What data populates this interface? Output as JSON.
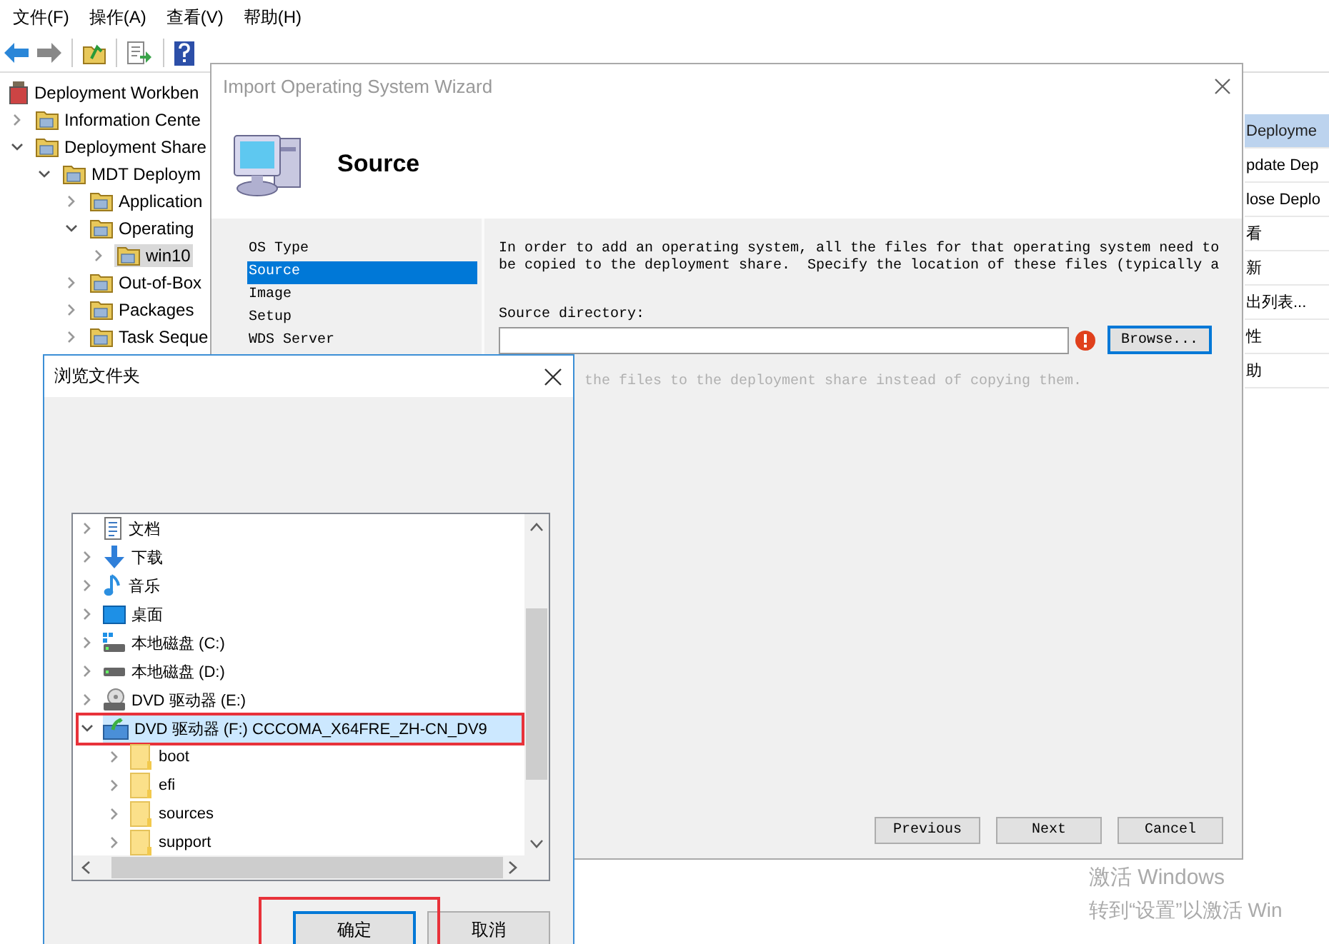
{
  "menu_bar": [
    "文件(F)",
    "操作(A)",
    "查看(V)",
    "帮助(H)"
  ],
  "tree": [
    {
      "label": "Deployment Workben",
      "selected": false,
      "children": [
        {
          "label": "Information Cente",
          "expanded": false,
          "selected": false
        },
        {
          "label": "Deployment Share",
          "expanded": true,
          "selected": false,
          "children": [
            {
              "label": "MDT Deploym",
              "expanded": true,
              "selected": false,
              "children": [
                {
                  "label": "Application",
                  "expanded": false,
                  "selected": false
                },
                {
                  "label": "Operating",
                  "expanded": true,
                  "selected": false,
                  "children": [
                    {
                      "label": "win10",
                      "expanded": false,
                      "selected": true
                    }
                  ]
                },
                {
                  "label": "Out-of-Box",
                  "expanded": false,
                  "selected": false
                },
                {
                  "label": "Packages",
                  "expanded": false,
                  "selected": false
                },
                {
                  "label": "Task Seque",
                  "expanded": false,
                  "selected": false
                }
              ]
            }
          ]
        }
      ]
    }
  ],
  "actions_pane": [
    {
      "label": "Deployme",
      "selected": true
    },
    {
      "label": "pdate Dep",
      "selected": false
    },
    {
      "label": "lose Deplo",
      "selected": false
    },
    {
      "label": "看",
      "selected": false
    },
    {
      "label": "新",
      "selected": false
    },
    {
      "label": "出列表...",
      "selected": false
    },
    {
      "label": "性",
      "selected": false
    },
    {
      "label": "助",
      "selected": false
    }
  ],
  "wizard": {
    "title": "Import Operating System Wizard",
    "heading": "Source",
    "steps": [
      {
        "label": "OS Type",
        "selected": false
      },
      {
        "label": "Source",
        "selected": true
      },
      {
        "label": "Image",
        "selected": false
      },
      {
        "label": "Setup",
        "selected": false
      },
      {
        "label": "WDS Server",
        "selected": false
      }
    ],
    "intro": [
      "In order to add an operating system, all the files for that operating system need to",
      "be copied to the deployment share.  Specify the location of these files (typically a"
    ],
    "source_label": "Source directory:",
    "source_error": true,
    "browse_button": "Browse...",
    "copy_option": {
      "label": "the files to the deployment share instead of copying them.",
      "disabled": true
    },
    "buttons": [
      "Previous",
      "Next",
      "Cancel"
    ]
  },
  "browse_dialog": {
    "title": "浏览文件夹",
    "items": [
      {
        "kind": "documents",
        "label": "文档",
        "expanded": false,
        "selected": false,
        "highlighted": false
      },
      {
        "kind": "downloads",
        "label": "下载",
        "expanded": false,
        "selected": false,
        "highlighted": false
      },
      {
        "kind": "music",
        "label": "音乐",
        "expanded": false,
        "selected": false,
        "highlighted": false
      },
      {
        "kind": "desktop",
        "label": "桌面",
        "expanded": false,
        "selected": false,
        "highlighted": false
      },
      {
        "kind": "system_disk",
        "label": "本地磁盘 (C:)",
        "expanded": false,
        "selected": false,
        "highlighted": false
      },
      {
        "kind": "disk",
        "label": "本地磁盘 (D:)",
        "expanded": false,
        "selected": false,
        "highlighted": false
      },
      {
        "kind": "dvd",
        "label": "DVD 驱动器 (E:)",
        "expanded": false,
        "selected": false,
        "highlighted": false
      },
      {
        "kind": "dvd_media",
        "label": "DVD 驱动器 (F:) CCCOMA_X64FRE_ZH-CN_DV9",
        "expanded": true,
        "selected": true,
        "highlighted": true,
        "children": [
          {
            "kind": "folder",
            "label": "boot",
            "expanded": false,
            "selected": false,
            "highlighted": false
          },
          {
            "kind": "folder",
            "label": "efi",
            "expanded": false,
            "selected": false,
            "highlighted": false
          },
          {
            "kind": "folder",
            "label": "sources",
            "expanded": false,
            "selected": false,
            "highlighted": false
          },
          {
            "kind": "folder",
            "label": "support",
            "expanded": false,
            "selected": false,
            "highlighted": false
          }
        ]
      }
    ],
    "buttons": [
      {
        "label": "确定",
        "default": true,
        "highlighted": true
      },
      {
        "label": "取消",
        "default": false,
        "highlighted": false
      }
    ]
  },
  "activation_notice": [
    "激活 Windows",
    "转到“设置”以激活 Win"
  ]
}
